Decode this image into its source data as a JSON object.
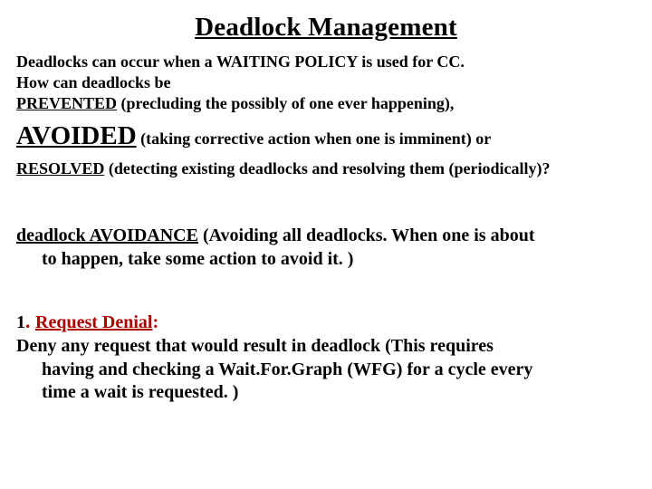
{
  "title": "Deadlock Management",
  "intro": {
    "line1": "Deadlocks can occur when a WAITING POLICY is used for CC.",
    "line2": "How can deadlocks be",
    "prevented": "PREVENTED",
    "prevented_rest": " (precluding the possibly of one ever happening),",
    "avoided": "AVOIDED",
    "avoided_rest": " (taking corrective action when one is imminent) or",
    "resolved": "RESOLVED",
    "resolved_rest": " (detecting existing deadlocks and resolving them (periodically)?"
  },
  "avoidance": {
    "head": "deadlock AVOIDANCE",
    "rest1": " (Avoiding all deadlocks. When one is about",
    "rest2": "to happen, take some action to avoid it. )"
  },
  "rd": {
    "num": "1",
    "dot": ". ",
    "title": "Request Denial",
    "colon": ":",
    "line1": "Deny any request that would result in deadlock (This requires",
    "line2": "having and checking a Wait.For.Graph (WFG) for a  cycle every",
    "line3": "time a wait is requested. )"
  }
}
